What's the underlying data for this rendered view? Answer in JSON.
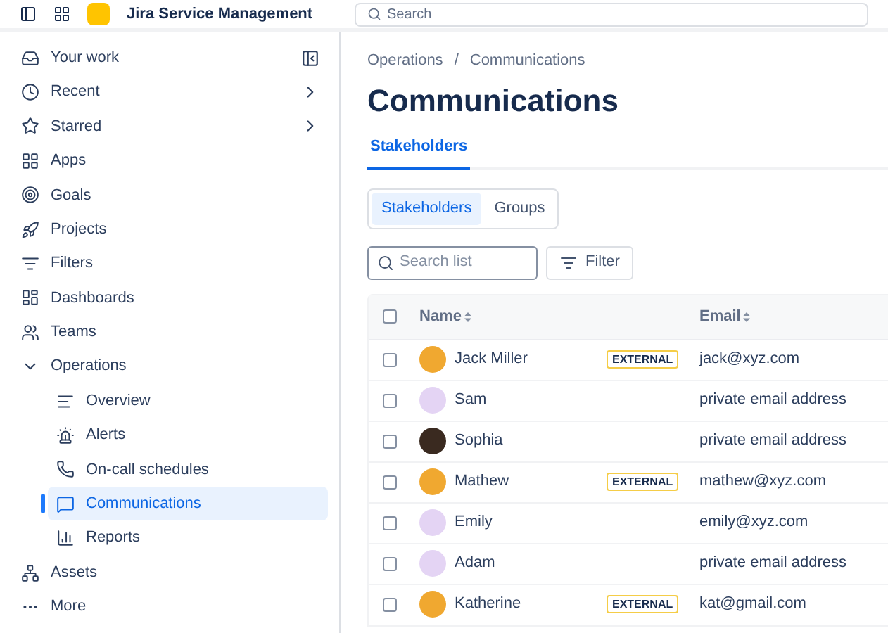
{
  "top_bar": {
    "product_name": "Jira Service Management",
    "search": {
      "placeholder": "Search"
    }
  },
  "sidebar": {
    "items": [
      {
        "label": "Your work",
        "selected": false
      },
      {
        "label": "Recent",
        "selected": false
      },
      {
        "label": "Starred",
        "selected": false
      },
      {
        "label": "Apps",
        "selected": false
      },
      {
        "label": "Goals",
        "selected": false
      },
      {
        "label": "Projects",
        "selected": false
      },
      {
        "label": "Filters",
        "selected": false
      },
      {
        "label": "Dashboards",
        "selected": false
      },
      {
        "label": "Teams",
        "selected": false
      },
      {
        "label": "Operations",
        "expanded": true,
        "selected": false,
        "children": [
          {
            "label": "Overview",
            "selected": false
          },
          {
            "label": "Alerts",
            "selected": false
          },
          {
            "label": "On-call schedules",
            "selected": false
          },
          {
            "label": "Communications",
            "selected": true
          },
          {
            "label": "Reports",
            "selected": false
          }
        ]
      },
      {
        "label": "Assets",
        "selected": false
      },
      {
        "label": "More",
        "selected": false
      }
    ]
  },
  "breadcrumbs": [
    "Operations",
    "Communications"
  ],
  "breadcrumb_separator": "/",
  "title": "Communications",
  "tabs": [
    {
      "label": "Stakeholders",
      "selected": true
    }
  ],
  "segmented": [
    {
      "label": "Stakeholders",
      "selected": true
    },
    {
      "label": "Groups",
      "selected": false
    }
  ],
  "search": {
    "placeholder": "Search list"
  },
  "filter_button": "Filter",
  "table": {
    "columns": [
      "Name",
      "Email"
    ],
    "header_checked": false,
    "rows": [
      {
        "name": "Jack Miller",
        "badge": "EXTERNAL",
        "email": "jack@xyz.com",
        "checked": false
      },
      {
        "name": "Sam",
        "email": "private email address",
        "checked": false
      },
      {
        "name": "Sophia",
        "email": "private email address",
        "checked": false
      },
      {
        "name": "Mathew",
        "badge": "EXTERNAL",
        "email": "mathew@xyz.com",
        "checked": false
      },
      {
        "name": "Emily",
        "email": "emily@xyz.com",
        "checked": false
      },
      {
        "name": "Adam",
        "email": "private email address",
        "checked": false
      },
      {
        "name": "Katherine",
        "badge": "EXTERNAL",
        "email": "kat@gmail.com",
        "checked": false
      }
    ]
  }
}
